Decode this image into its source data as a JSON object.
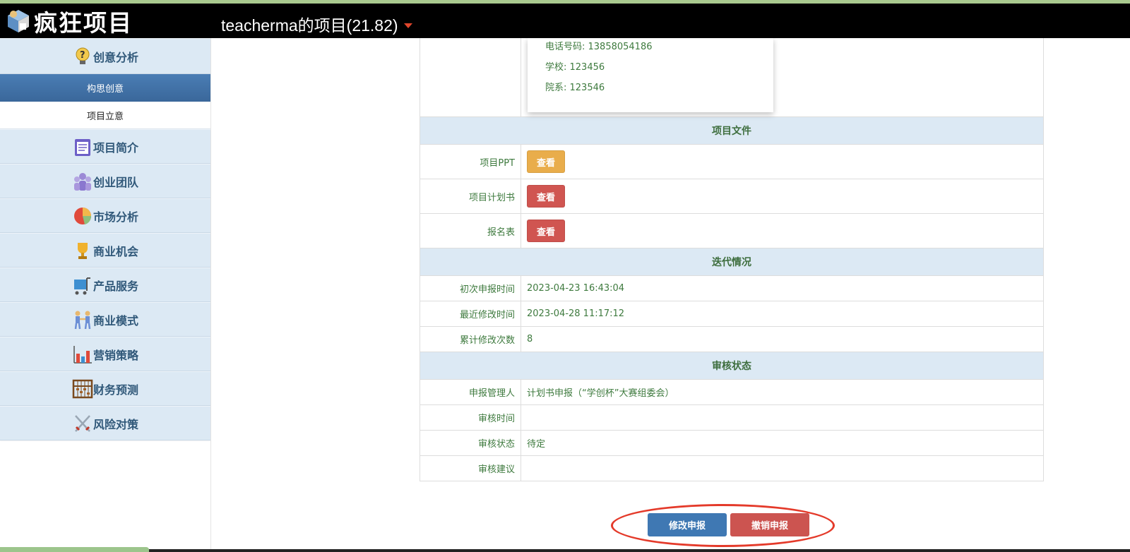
{
  "header": {
    "logo_text": "疯狂项目",
    "project_title": "teacherma的项目(21.82)"
  },
  "sidebar": {
    "groups": [
      {
        "label": "创意分析",
        "icon": "lightbulb-question-icon"
      },
      {
        "label": "项目简介",
        "icon": "clipboard-icon"
      },
      {
        "label": "创业团队",
        "icon": "team-icon"
      },
      {
        "label": "市场分析",
        "icon": "pie-chart-icon"
      },
      {
        "label": "商业机会",
        "icon": "trophy-icon"
      },
      {
        "label": "产品服务",
        "icon": "cart-icon"
      },
      {
        "label": "商业模式",
        "icon": "handshake-people-icon"
      },
      {
        "label": "营销策略",
        "icon": "bar-chart-icon"
      },
      {
        "label": "财务预测",
        "icon": "abacus-icon"
      },
      {
        "label": "风险对策",
        "icon": "crossed-swords-icon"
      }
    ],
    "sub_items": [
      {
        "label": "构思创意",
        "active": true
      },
      {
        "label": "项目立意",
        "active": false
      }
    ]
  },
  "applicant_info": {
    "phone": "电话号码: 13858054186",
    "school": "学校: 123456",
    "department": "院系: 123546"
  },
  "files_section": {
    "title": "项目文件",
    "rows": [
      {
        "label": "项目PPT",
        "button": "查看",
        "color": "#e9ad4b"
      },
      {
        "label": "项目计划书",
        "button": "查看",
        "color": "#d05551"
      },
      {
        "label": "报名表",
        "button": "查看",
        "color": "#d05551"
      }
    ]
  },
  "iteration_section": {
    "title": "迭代情况",
    "rows": [
      {
        "label": "初次申报时间",
        "value": "2023-04-23 16:43:04"
      },
      {
        "label": "最近修改时间",
        "value": "2023-04-28 11:17:12"
      },
      {
        "label": "累计修改次数",
        "value": "8"
      }
    ]
  },
  "review_section": {
    "title": "审核状态",
    "rows": [
      {
        "label": "申报管理人",
        "value": "计划书申报（“学创杯”大赛组委会）"
      },
      {
        "label": "审核时间",
        "value": ""
      },
      {
        "label": "审核状态",
        "value": "待定"
      },
      {
        "label": "审核建议",
        "value": ""
      }
    ]
  },
  "actions": {
    "modify_label": "修改申报",
    "cancel_label": "撤销申报"
  },
  "colors": {
    "header_bg": "#000000",
    "sidebar_group_bg": "#dce9f4",
    "active_sub_bg": "#3f78b3",
    "section_bg": "#dce9f4",
    "text_green": "#3e7a3e",
    "highlight_ellipse": "#e43a2a"
  }
}
